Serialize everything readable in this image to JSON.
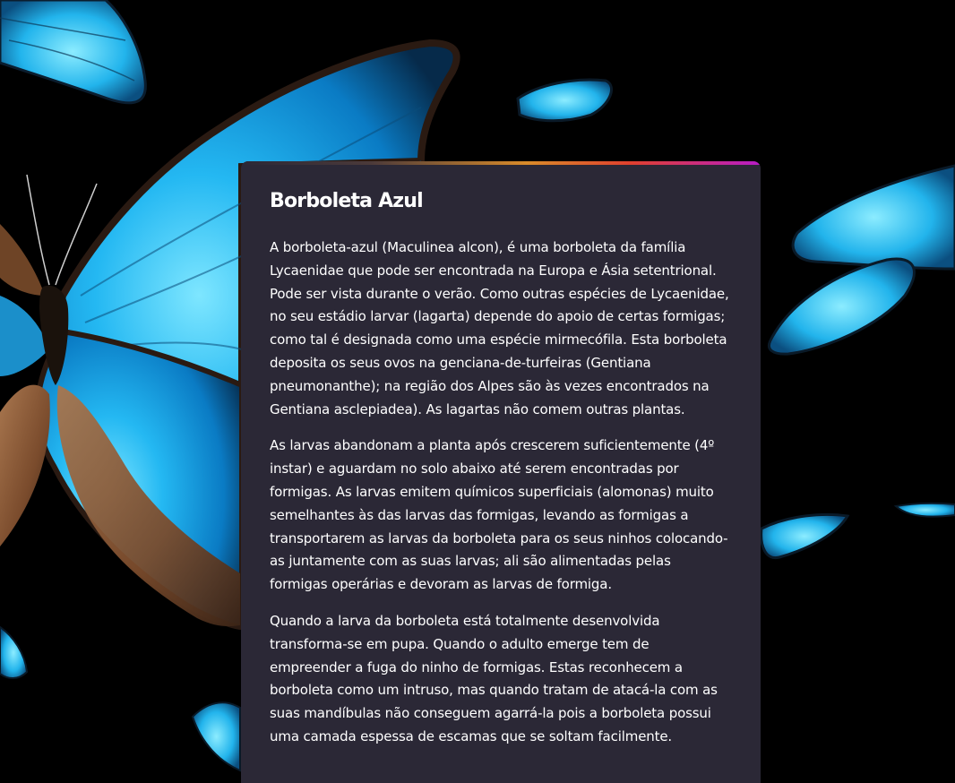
{
  "article": {
    "title": "Borboleta Azul",
    "paragraphs": [
      "A borboleta-azul (Maculinea alcon), é uma borboleta da família Lycaenidae que pode ser encontrada na Europa e Ásia setentrional. Pode ser vista durante o verão. Como outras espécies de Lycaenidae, no seu estádio larvar (lagarta) depende do apoio de certas formigas; como tal é designada como uma espécie mirmecófila. Esta borboleta deposita os seus ovos na genciana-de-turfeiras (Gentiana pneumonanthe); na região dos Alpes são às vezes encontrados na Gentiana asclepiadea). As lagartas não comem outras plantas.",
      "As larvas abandonam a planta após crescerem suficientemente (4º instar) e aguardam no solo abaixo até serem encontradas por formigas. As larvas emitem químicos superficiais (alomonas) muito semelhantes às das larvas das formigas, levando as formigas a transportarem as larvas da borboleta para os seus ninhos colocando-as juntamente com as suas larvas; ali são alimentadas pelas formigas operárias e devoram as larvas de formiga.",
      "Quando a larva da borboleta está totalmente desenvolvida transforma-se em pupa. Quando o adulto emerge tem de empreender a fuga do ninho de formigas. Estas reconhecem a borboleta como um intruso, mas quando tratam de atacá-la com as suas mandíbulas não conseguem agarrá-la pois a borboleta possui uma camada espessa de escamas que se soltam facilmente."
    ]
  },
  "colors": {
    "background": "#000000",
    "card": "#2b2836",
    "text": "#ffffff",
    "wing_blue": "#1fb3f0",
    "wing_edge": "#2a1a12",
    "underside_brown": "#8a5a3a"
  }
}
